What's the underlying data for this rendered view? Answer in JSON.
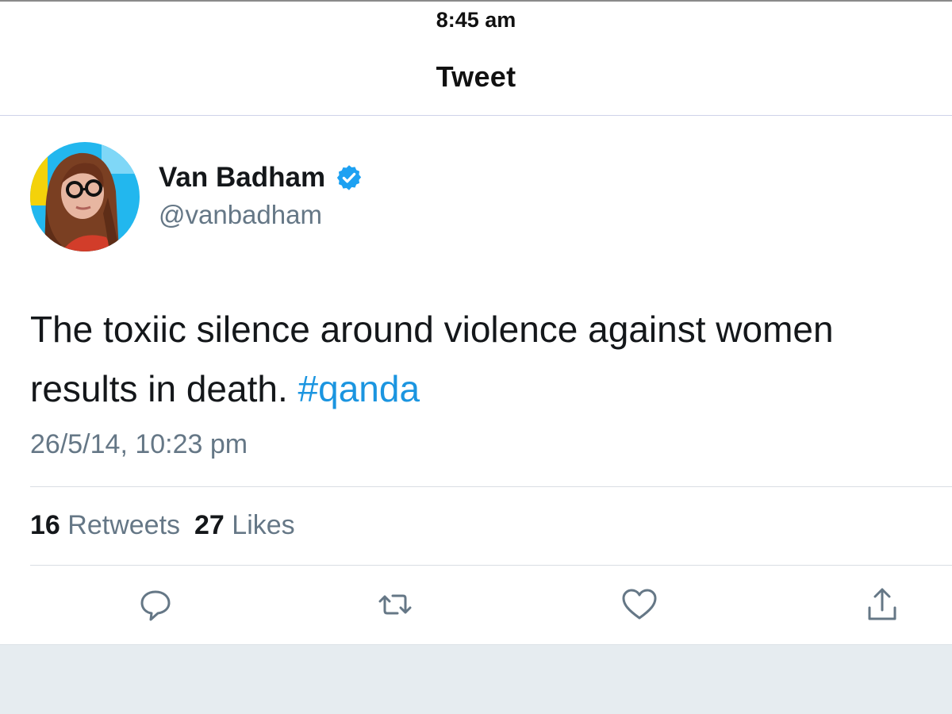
{
  "status_bar": {
    "time": "8:45 am"
  },
  "nav": {
    "title": "Tweet"
  },
  "tweet": {
    "display_name": "Van Badham",
    "handle": "@vanbadham",
    "text": "The toxiic silence around violence against women results in death.",
    "hashtag": "#qanda",
    "timestamp": "26/5/14, 10:23 pm",
    "retweets_count": "16",
    "retweets_label": "Retweets",
    "likes_count": "27",
    "likes_label": "Likes"
  },
  "icons": {
    "verified": "verified-badge-icon",
    "reply": "reply-icon",
    "retweet": "retweet-icon",
    "like": "heart-icon",
    "share": "share-icon"
  },
  "colors": {
    "accent": "#1b95e0",
    "verified": "#1da1f2",
    "secondary_text": "#657786",
    "primary_text": "#14171a",
    "footer_bg": "#e6ecf0"
  }
}
